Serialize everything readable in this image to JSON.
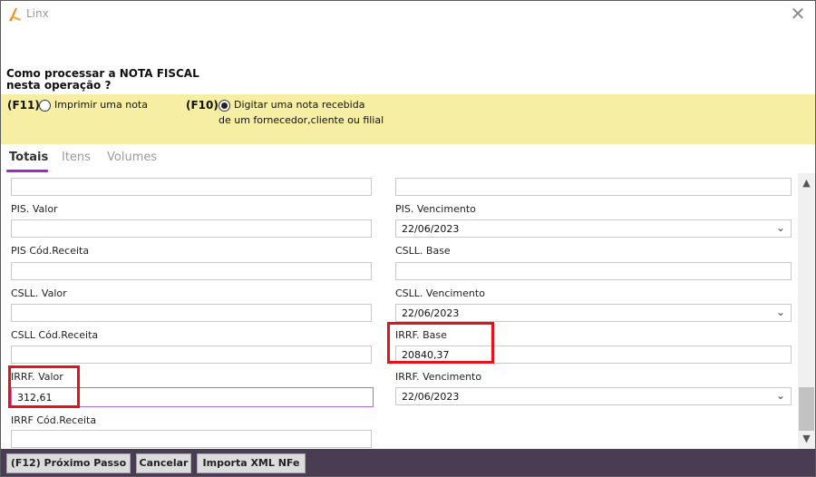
{
  "window": {
    "title": "Linx",
    "close_glyph": "✕"
  },
  "question": {
    "line1": "Como processar a NOTA FISCAL",
    "line2": "nesta operação ?"
  },
  "options": {
    "print": {
      "key": "(F11)",
      "label": "Imprimir uma nota",
      "checked": false
    },
    "receive": {
      "key": "(F10)",
      "label_line1": "Digitar uma nota recebida",
      "label_line2": "de um fornecedor,cliente ou filial",
      "checked": true
    }
  },
  "tabs": [
    {
      "label": "Totais",
      "active": true
    },
    {
      "label": "Itens",
      "active": false
    },
    {
      "label": "Volumes",
      "active": false
    }
  ],
  "form": {
    "top_left_value": "",
    "top_right_value": "",
    "pis_valor": {
      "label": "PIS. Valor",
      "value": ""
    },
    "pis_vencimento": {
      "label": "PIS. Vencimento",
      "value": "22/06/2023"
    },
    "pis_cod_receita": {
      "label": "PIS Cód.Receita",
      "value": ""
    },
    "csll_base": {
      "label": "CSLL. Base",
      "value": ""
    },
    "csll_valor": {
      "label": "CSLL. Valor",
      "value": ""
    },
    "csll_vencimento": {
      "label": "CSLL. Vencimento",
      "value": "22/06/2023"
    },
    "csll_cod_receita": {
      "label": "CSLL Cód.Receita",
      "value": ""
    },
    "irrf_base": {
      "label": "IRRF. Base",
      "value": "20840,37"
    },
    "irrf_valor": {
      "label": "IRRF. Valor",
      "value": "312,61"
    },
    "irrf_vencimento": {
      "label": "IRRF. Vencimento",
      "value": "22/06/2023"
    },
    "irrf_cod_receita": {
      "label": "IRRF Cód.Receita",
      "value": ""
    }
  },
  "scroll": {
    "up_glyph": "▲",
    "down_glyph": "▼"
  },
  "footer": {
    "next_step": "(F12) Próximo Passo",
    "cancel": "Cancelar",
    "import_xml": "Importa XML NFe"
  },
  "colors": {
    "accent": "#9b2cc9",
    "choice_band": "#f5eea3",
    "footer_bg": "#4a3c52",
    "highlight": "#e8101c"
  }
}
